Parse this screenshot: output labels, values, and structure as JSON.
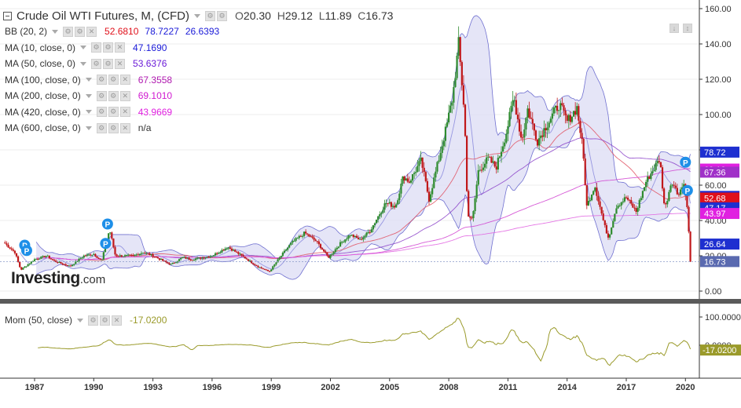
{
  "header": {
    "title": "Crude Oil WTI Futures, M, (CFD)",
    "ohlc": [
      {
        "key": "O",
        "value": "20.30"
      },
      {
        "key": "H",
        "value": "29.12"
      },
      {
        "key": "L",
        "value": "11.89"
      },
      {
        "key": "C",
        "value": "16.73"
      }
    ]
  },
  "indicators": [
    {
      "label": "BB (20, 2)",
      "values": [
        {
          "text": "52.6810",
          "color": "#e0101a"
        },
        {
          "text": "78.7227",
          "color": "#1a1ad8"
        },
        {
          "text": "26.6393",
          "color": "#1a1ad8"
        }
      ]
    },
    {
      "label": "MA (10, close, 0)",
      "values": [
        {
          "text": "47.1690",
          "color": "#1a1ad8"
        }
      ]
    },
    {
      "label": "MA (50, close, 0)",
      "values": [
        {
          "text": "53.6376",
          "color": "#6a1ad8"
        }
      ]
    },
    {
      "label": "MA (100, close, 0)",
      "values": [
        {
          "text": "67.3558",
          "color": "#b01ab0"
        }
      ]
    },
    {
      "label": "MA (200, close, 0)",
      "values": [
        {
          "text": "69.1010",
          "color": "#d01ad0"
        }
      ]
    },
    {
      "label": "MA (420, close, 0)",
      "values": [
        {
          "text": "43.9669",
          "color": "#e020e0"
        }
      ]
    },
    {
      "label": "MA (600, close, 0)",
      "values": [
        {
          "text": "n/a",
          "color": "#333333"
        }
      ]
    }
  ],
  "logo": {
    "main": "Investing",
    "suffix": ".com"
  },
  "momentum": {
    "label": "Mom (50, close)",
    "value": "-17.0200",
    "color": "#9a9a2a"
  },
  "colors": {
    "up": "#2e8b2e",
    "down": "#c0181a",
    "band_fill": "#dcdcf4",
    "band_line": "#7070d0",
    "ma10": "#8888dd",
    "ma50": "#e05060",
    "ma100": "#8a40c8",
    "ma200": "#d040d0",
    "ma420": "#e060e0",
    "momentum": "#9a9a2a",
    "grid": "#eeeeee",
    "axis": "#333333"
  },
  "chart_data": [
    {
      "type": "candlestick",
      "title": "Crude Oil WTI Futures, M, (CFD)",
      "x_ticks": [
        "1987",
        "1990",
        "1993",
        "1996",
        "1999",
        "2002",
        "2005",
        "2008",
        "2011",
        "2014",
        "2017",
        "2020"
      ],
      "ylim": [
        0,
        160
      ],
      "y_ticks": [
        "160.00",
        "140.00",
        "120.00",
        "100.00",
        "80.00",
        "60.00",
        "40.00",
        "20.00",
        "0.00"
      ],
      "anchors_year_close": [
        [
          1985.5,
          27
        ],
        [
          1986.0,
          22
        ],
        [
          1986.3,
          12
        ],
        [
          1987.0,
          18
        ],
        [
          1987.6,
          20
        ],
        [
          1988.0,
          17
        ],
        [
          1988.8,
          14
        ],
        [
          1989.5,
          20
        ],
        [
          1990.0,
          21
        ],
        [
          1990.4,
          17
        ],
        [
          1990.8,
          35
        ],
        [
          1991.1,
          20
        ],
        [
          1992.0,
          20
        ],
        [
          1992.5,
          22
        ],
        [
          1993.0,
          20
        ],
        [
          1993.9,
          15
        ],
        [
          1994.5,
          19
        ],
        [
          1995.0,
          18
        ],
        [
          1996.0,
          20
        ],
        [
          1996.8,
          25
        ],
        [
          1997.5,
          20
        ],
        [
          1998.3,
          14
        ],
        [
          1998.9,
          11
        ],
        [
          1999.5,
          20
        ],
        [
          2000.0,
          27
        ],
        [
          2000.7,
          33
        ],
        [
          2001.3,
          28
        ],
        [
          2001.9,
          19
        ],
        [
          2002.5,
          27
        ],
        [
          2003.0,
          32
        ],
        [
          2003.5,
          29
        ],
        [
          2004.0,
          34
        ],
        [
          2004.8,
          50
        ],
        [
          2005.3,
          48
        ],
        [
          2005.7,
          65
        ],
        [
          2006.0,
          62
        ],
        [
          2006.6,
          74
        ],
        [
          2007.0,
          52
        ],
        [
          2007.5,
          75
        ],
        [
          2007.9,
          94
        ],
        [
          2008.2,
          110
        ],
        [
          2008.5,
          140
        ],
        [
          2008.8,
          100
        ],
        [
          2008.95,
          44
        ],
        [
          2009.2,
          40
        ],
        [
          2009.5,
          68
        ],
        [
          2010.0,
          75
        ],
        [
          2010.4,
          70
        ],
        [
          2010.9,
          89
        ],
        [
          2011.3,
          110
        ],
        [
          2011.7,
          85
        ],
        [
          2012.0,
          103
        ],
        [
          2012.5,
          85
        ],
        [
          2013.0,
          95
        ],
        [
          2013.6,
          106
        ],
        [
          2014.0,
          96
        ],
        [
          2014.5,
          104
        ],
        [
          2014.8,
          80
        ],
        [
          2015.0,
          48
        ],
        [
          2015.4,
          60
        ],
        [
          2015.9,
          37
        ],
        [
          2016.1,
          30
        ],
        [
          2016.5,
          48
        ],
        [
          2017.0,
          53
        ],
        [
          2017.5,
          45
        ],
        [
          2018.0,
          62
        ],
        [
          2018.7,
          75
        ],
        [
          2018.95,
          46
        ],
        [
          2019.3,
          63
        ],
        [
          2019.6,
          55
        ],
        [
          2019.95,
          61
        ],
        [
          2020.1,
          45
        ],
        [
          2020.25,
          20
        ],
        [
          2020.3,
          16.73
        ]
      ],
      "last_close": 16.73
    },
    {
      "type": "line",
      "title": "Mom (50, close)",
      "ylim": [
        -100,
        100
      ],
      "y_ticks": [
        "100.0000",
        "0.0000",
        "-17.0200"
      ]
    }
  ],
  "price_labels": [
    {
      "text": "78.72",
      "bg": "#1e2fd0",
      "fg": "#ffffff",
      "value": 78.72
    },
    {
      "text": "69.10",
      "bg": "#e020e0",
      "fg": "#ffffff",
      "value": 69.1
    },
    {
      "text": "67.36",
      "bg": "#a030c8",
      "fg": "#ffffff",
      "value": 67.36
    },
    {
      "text": "53.64",
      "bg": "#1e2fd0",
      "fg": "#ffffff",
      "value": 53.64
    },
    {
      "text": "52.68",
      "bg": "#e0101a",
      "fg": "#ffffff",
      "value": 52.68
    },
    {
      "text": "47.17",
      "bg": "#1e2fd0",
      "fg": "#ffffff",
      "value": 47.17
    },
    {
      "text": "43.97",
      "bg": "#e020e0",
      "fg": "#ffffff",
      "value": 43.97
    },
    {
      "text": "26.64",
      "bg": "#1e2fd0",
      "fg": "#ffffff",
      "value": 26.64
    },
    {
      "text": "16.73",
      "bg": "#5a6ab0",
      "fg": "#ffffff",
      "value": 16.73
    }
  ],
  "markers": [
    {
      "text": "P",
      "year": 1986.5,
      "value": 26
    },
    {
      "text": "P",
      "year": 1986.6,
      "value": 23
    },
    {
      "text": "P",
      "year": 1990.6,
      "value": 27
    },
    {
      "text": "P",
      "year": 1990.7,
      "value": 38
    },
    {
      "text": "P",
      "year": 2020.0,
      "value": 73
    },
    {
      "text": "P",
      "year": 2020.1,
      "value": 57
    }
  ]
}
